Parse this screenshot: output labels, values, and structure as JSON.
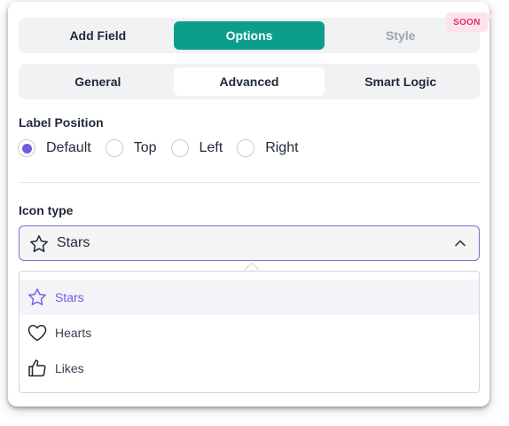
{
  "top_tabs": [
    {
      "label": "Add Field",
      "state": "normal"
    },
    {
      "label": "Options",
      "state": "active"
    },
    {
      "label": "Style",
      "state": "disabled"
    }
  ],
  "badge": {
    "label": "SOON",
    "color": "#d63366"
  },
  "sub_tabs": [
    {
      "label": "General",
      "state": "normal"
    },
    {
      "label": "Advanced",
      "state": "active"
    },
    {
      "label": "Smart Logic",
      "state": "normal"
    }
  ],
  "label_position": {
    "title": "Label Position",
    "options": [
      "Default",
      "Top",
      "Left",
      "Right"
    ],
    "selected": "Default"
  },
  "icon_type": {
    "title": "Icon type",
    "selected_label": "Stars",
    "selected_icon": "star-icon",
    "expanded": true,
    "options": [
      {
        "label": "Stars",
        "icon": "star-icon",
        "selected": true
      },
      {
        "label": "Hearts",
        "icon": "heart-icon",
        "selected": false
      },
      {
        "label": "Likes",
        "icon": "thumbs-up-icon",
        "selected": false
      }
    ]
  },
  "colors": {
    "accent_teal": "#0b9e8c",
    "accent_purple": "#6f5ce0",
    "badge_bg": "#fde4ea"
  }
}
